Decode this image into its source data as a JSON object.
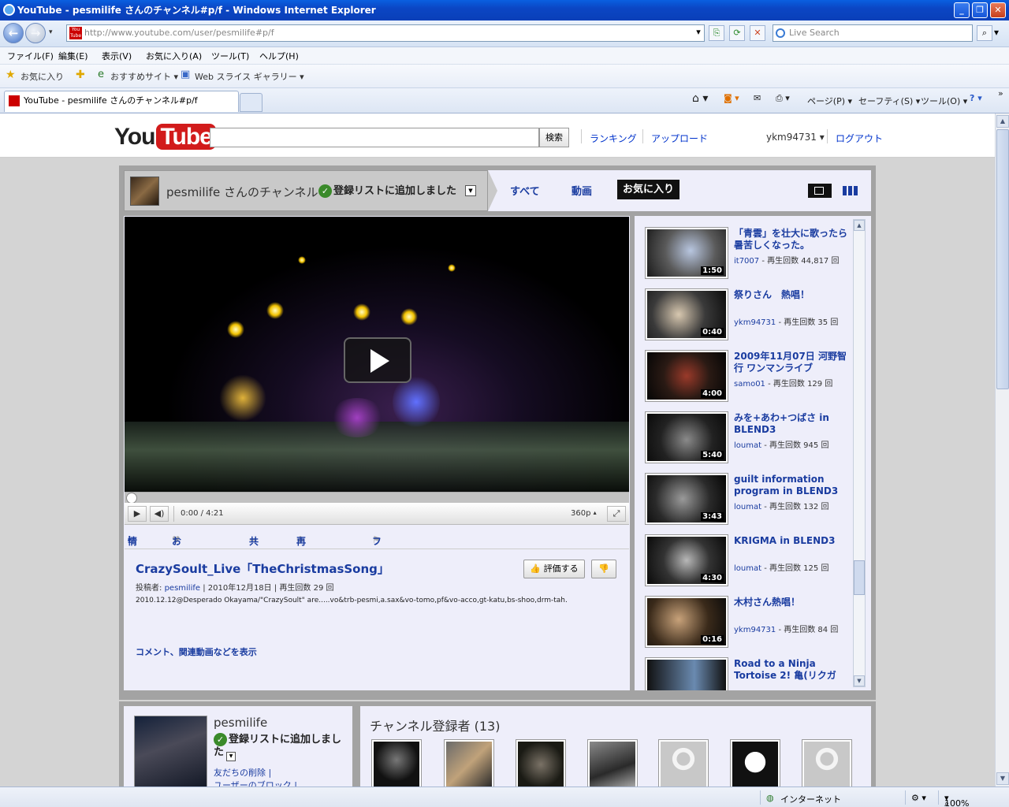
{
  "window": {
    "title": "YouTube - pesmilife さんのチャンネル#p/f - Windows Internet Explorer",
    "minimize": "_",
    "maximize": "❐",
    "close": "✕"
  },
  "address": {
    "url": "http://www.youtube.com/user/pesmilife#p/f",
    "search_placeholder": "Live Search"
  },
  "menu": [
    "ファイル(F)",
    "編集(E)",
    "表示(V)",
    "お気に入り(A)",
    "ツール(T)",
    "ヘルプ(H)"
  ],
  "favbar": {
    "favorites": "お気に入り",
    "suggested": "おすすめサイト ▾",
    "slice": "Web スライス ギャラリー ▾"
  },
  "tab": {
    "label": "YouTube - pesmilife さんのチャンネル#p/f"
  },
  "commandbar": {
    "page": "ページ(P) ▾",
    "safety": "セーフティ(S) ▾",
    "tools": "ツール(O) ▾"
  },
  "yt": {
    "logo_you": "You",
    "logo_tube": "Tube",
    "search_button": "検索",
    "nav_ranking": "ランキング",
    "nav_upload": "アップロード",
    "username": "ykm94731",
    "logout": "ログアウト"
  },
  "channel": {
    "name": "pesmilife さんのチャンネル",
    "subscribed": "登録リストに追加しました",
    "tabs": {
      "all": "すべて",
      "videos": "動画",
      "favorites": "お気に入り"
    }
  },
  "player": {
    "time": "0:00 / 4:21",
    "quality": "360p",
    "progress_fraction": 0.0
  },
  "action_tabs": {
    "info": "情報",
    "favorite": "お気に入り",
    "share": "共有",
    "playlist": "再生リスト",
    "flag": "フラグ"
  },
  "video": {
    "title": "CrazySoult_Live「TheChristmasSong」",
    "uploader_prefix": "投稿者:",
    "uploader": "pesmilife",
    "date": "| 2010年12月18日",
    "views": "| 再生回数 29 回",
    "description": "2010.12.12@Desperado Okayama/\"CrazySoult\" are.....vo&trb-pesmi,a.sax&vo-tomo,pf&vo-acco,gt-katu,bs-shoo,drm-tah.",
    "more": "コメント、関連動画などを表示",
    "rate_button": "評価する"
  },
  "video_list": [
    {
      "title": "「青雲」を壮大に歌ったら暑苦しくなった。",
      "user": "it7007",
      "views": " - 再生回数 44,817 回",
      "duration": "1:50"
    },
    {
      "title": "祭りさん　熱唱！",
      "user": "ykm94731",
      "views": " - 再生回数 35 回",
      "duration": "0:40"
    },
    {
      "title": "2009年11月07日 河野智行 ワンマンライブ",
      "user": "samo01",
      "views": " - 再生回数 129 回",
      "duration": "4:00"
    },
    {
      "title": "みを+あわ+つばさ in BLEND3",
      "user": "loumat",
      "views": " - 再生回数 945 回",
      "duration": "5:40"
    },
    {
      "title": "guilt information program in BLEND3",
      "user": "loumat",
      "views": " - 再生回数 132 回",
      "duration": "3:43"
    },
    {
      "title": "KRIGMA in BLEND3",
      "user": "loumat",
      "views": " - 再生回数 125 回",
      "duration": "4:30"
    },
    {
      "title": "木村さん熱唱！",
      "user": "ykm94731",
      "views": " - 再生回数 84 回",
      "duration": "0:16"
    },
    {
      "title": "Road to a Ninja Tortoise 2! 亀(リクガ",
      "user": "",
      "views": "",
      "duration": ""
    }
  ],
  "profile": {
    "name": "pesmilife",
    "subscribed": "登録リストに追加しました",
    "remove_friend": "友だちの削除 |",
    "block_user": "ユーザーのブロック |"
  },
  "subscribers": {
    "title": "チャンネル登録者 (13)"
  },
  "statusbar": {
    "zone": "インターネット",
    "zoom": "100%"
  },
  "colors": {
    "link": "#1a3ca0",
    "youtube_red": "#d21b1b",
    "channel_bg": "#a3a3a3",
    "panel_bg": "#eeeefa"
  }
}
